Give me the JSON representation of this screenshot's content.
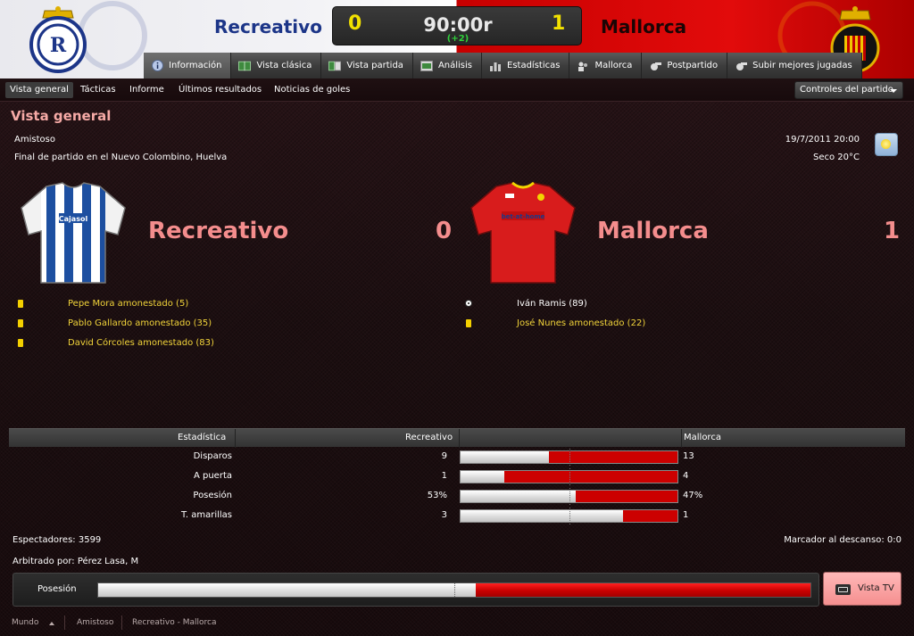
{
  "header": {
    "home_team": "Recreativo",
    "away_team": "Mallorca",
    "home_score": "0",
    "away_score": "1",
    "clock": "90:00r",
    "added_time": "(+2)",
    "colors": {
      "home": "#1c3588",
      "away": "#c70000",
      "score": "#f2e100",
      "added_time": "#2fd13b"
    }
  },
  "nav": {
    "tabs": [
      {
        "label": "Información",
        "icon": "info-icon",
        "active": true
      },
      {
        "label": "Vista clásica",
        "icon": "pitch-icon"
      },
      {
        "label": "Vista partida",
        "icon": "split-view-icon"
      },
      {
        "label": "Análisis",
        "icon": "analysis-icon"
      },
      {
        "label": "Estadísticas",
        "icon": "stats-icon"
      },
      {
        "label": "Mallorca",
        "icon": "team-icon"
      },
      {
        "label": "Postpartido",
        "icon": "whistle-icon"
      },
      {
        "label": "Subir mejores jugadas",
        "icon": "upload-icon"
      }
    ]
  },
  "subnav": {
    "tabs": [
      "Vista general",
      "Tácticas",
      "Informe",
      "Últimos resultados",
      "Noticias de goles"
    ],
    "controls": "Controles del partido"
  },
  "overview": {
    "title": "Vista general",
    "competition": "Amistoso",
    "venue": "Final de partido en el Nuevo Colombino, Huelva",
    "datetime": "19/7/2011 20:00",
    "weather": "Seco 20°C",
    "weather_icon": "sun-icon",
    "home_team": "Recreativo",
    "home_score": "0",
    "away_team": "Mallorca",
    "away_score": "1",
    "home_events": [
      {
        "type": "yellow-card",
        "text": "Pepe Mora amonestado (5)"
      },
      {
        "type": "yellow-card",
        "text": "Pablo Gallardo amonestado (35)"
      },
      {
        "type": "yellow-card",
        "text": "David Córcoles amonestado (83)"
      }
    ],
    "away_events": [
      {
        "type": "goal",
        "text": "Iván Ramis (89)"
      },
      {
        "type": "yellow-card",
        "text": "José Nunes amonestado (22)"
      }
    ],
    "home_sponsor": "Cajasol",
    "away_sponsor": "bet-at-home"
  },
  "stats": {
    "headers": {
      "stat": "Estadística",
      "home": "Recreativo",
      "away": "Mallorca"
    },
    "rows": [
      {
        "label": "Disparos",
        "home": "9",
        "away": "13",
        "home_share": 0.409
      },
      {
        "label": "A puerta",
        "home": "1",
        "away": "4",
        "home_share": 0.2
      },
      {
        "label": "Posesión",
        "home": "53%",
        "away": "47%",
        "home_share": 0.53
      },
      {
        "label": "T. amarillas",
        "home": "3",
        "away": "1",
        "home_share": 0.75
      }
    ]
  },
  "match_info": {
    "attendance": "Espectadores: 3599",
    "halftime": "Marcador al descanso: 0:0",
    "referee": "Arbitrado por: Pérez Lasa, M"
  },
  "possession": {
    "label": "Posesión",
    "home_share": 0.53
  },
  "tv_button": "Vista TV",
  "footer": {
    "crumbs": [
      "Mundo",
      "Amistoso",
      "Recreativo - Mallorca"
    ]
  }
}
